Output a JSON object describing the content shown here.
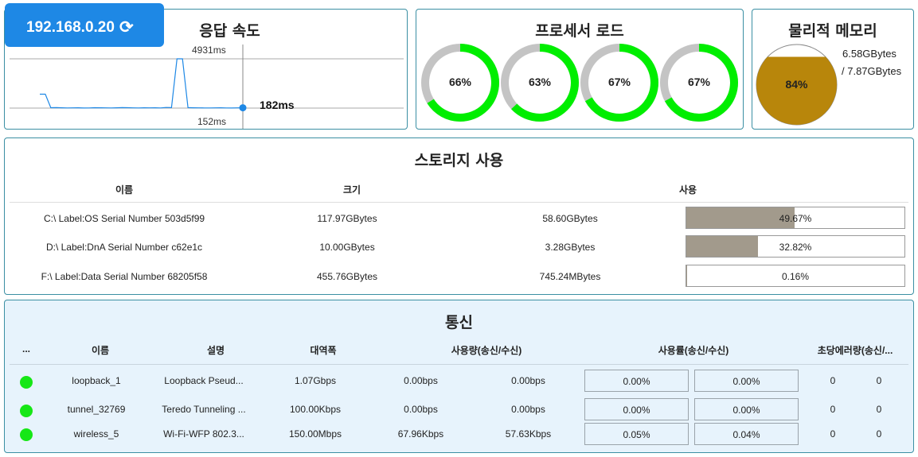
{
  "response": {
    "ip": "192.168.0.20",
    "refresh_icon": "refresh-icon",
    "title": "응답 속도",
    "max_label": "4931ms",
    "min_label": "152ms",
    "current_label": "182ms",
    "series_ms": [
      1500,
      1500,
      190,
      200,
      180,
      170,
      175,
      185,
      160,
      170,
      190,
      180,
      175,
      165,
      180,
      200,
      190,
      175,
      170,
      180,
      175,
      185,
      170,
      210,
      200,
      4931,
      4931,
      200,
      180,
      175,
      170,
      165,
      175,
      180,
      170,
      160,
      175,
      182
    ],
    "accent": "#1e88e5"
  },
  "cpu": {
    "title": "프로세서 로드",
    "cores": [
      {
        "label": "66%",
        "value": 66
      },
      {
        "label": "63%",
        "value": 63
      },
      {
        "label": "67%",
        "value": 67
      },
      {
        "label": "67%",
        "value": 67
      }
    ],
    "fill_color": "#00ee00",
    "track_color": "#c4c4c4"
  },
  "memory": {
    "title": "물리적 메모리",
    "percent_label": "84%",
    "percent": 84,
    "used": "6.58GBytes",
    "total": "/ 7.87GBytes",
    "fill_color": "#b8860b"
  },
  "storage": {
    "title": "스토리지 사용",
    "headers": [
      "이름",
      "크기",
      "사용"
    ],
    "rows": [
      {
        "name": "C:\\ Label:OS Serial Number 503d5f99",
        "size": "117.97GBytes",
        "used": "58.60GBytes",
        "percent_label": "49.67%",
        "percent": 49.67
      },
      {
        "name": "D:\\ Label:DnA Serial Number c62e1c",
        "size": "10.00GBytes",
        "used": "3.28GBytes",
        "percent_label": "32.82%",
        "percent": 32.82
      },
      {
        "name": "F:\\ Label:Data Serial Number 68205f58",
        "size": "455.76GBytes",
        "used": "745.24MBytes",
        "percent_label": "0.16%",
        "percent": 0.16
      }
    ],
    "bar_color": "#a29a8c"
  },
  "network": {
    "title": "통신",
    "headers": [
      "...",
      "이름",
      "설명",
      "대역폭",
      "사용량(송신/수신)",
      "사용률(송신/수신)",
      "초당에러량(송신/..."
    ],
    "rows": [
      {
        "name": "loopback_1",
        "desc": "Loopback Pseud...",
        "bandwidth": "1.07Gbps",
        "tx": "0.00bps",
        "rx": "0.00bps",
        "tx_rate": "0.00%",
        "rx_rate": "0.00%",
        "err_tx": "0",
        "err_rx": "0"
      },
      {
        "name": "tunnel_32769",
        "desc": "Teredo Tunneling ...",
        "bandwidth": "100.00Kbps",
        "tx": "0.00bps",
        "rx": "0.00bps",
        "tx_rate": "0.00%",
        "rx_rate": "0.00%",
        "err_tx": "0",
        "err_rx": "0"
      },
      {
        "name": "wireless_5",
        "desc": "Wi-Fi-WFP 802.3...",
        "bandwidth": "150.00Mbps",
        "tx": "67.96Kbps",
        "rx": "57.63Kbps",
        "tx_rate": "0.05%",
        "rx_rate": "0.04%",
        "err_tx": "0",
        "err_rx": "0"
      }
    ],
    "status_color": "#16e716"
  }
}
